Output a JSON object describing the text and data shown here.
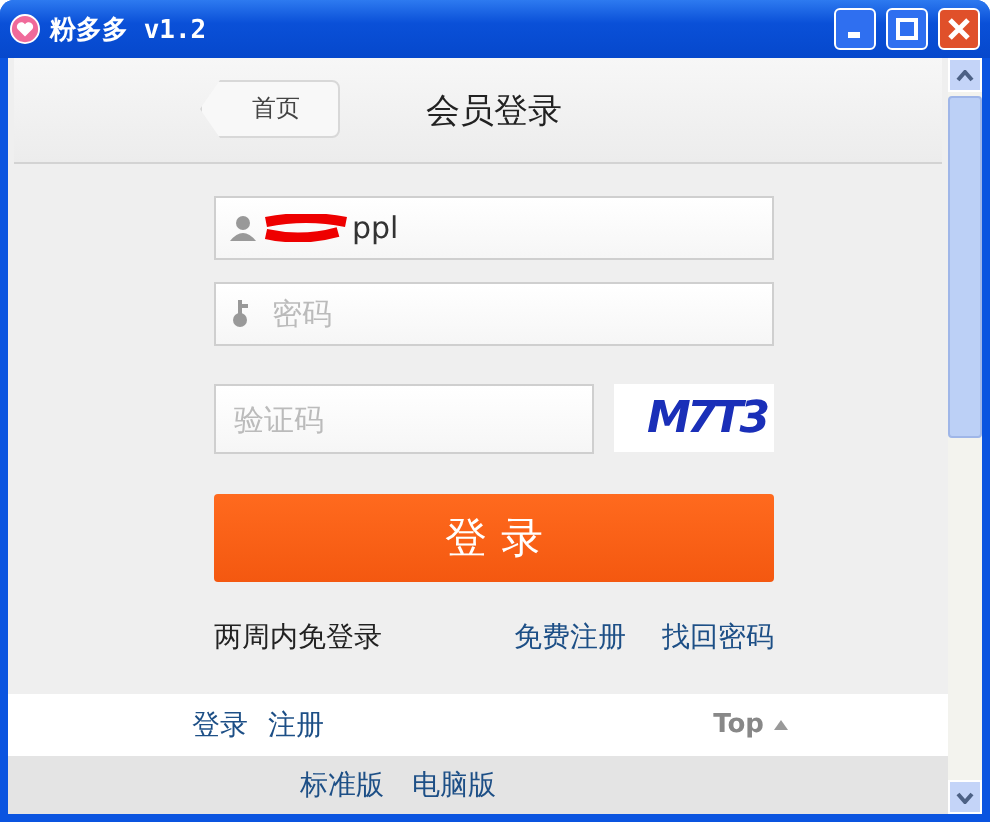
{
  "window": {
    "title": "粉多多 v1.2"
  },
  "header": {
    "back": "首页",
    "title": "会员登录"
  },
  "form": {
    "username": {
      "value": "ppl"
    },
    "password": {
      "placeholder": "密码"
    },
    "captcha": {
      "placeholder": "验证码",
      "code": "M7T3"
    },
    "submit": "登 录"
  },
  "links": {
    "remember": "两周内免登录",
    "register": "免费注册",
    "recover": "找回密码"
  },
  "footer": {
    "links": [
      "登录",
      "注册"
    ],
    "top": "Top",
    "versions": [
      "标准版",
      "电脑版"
    ]
  }
}
